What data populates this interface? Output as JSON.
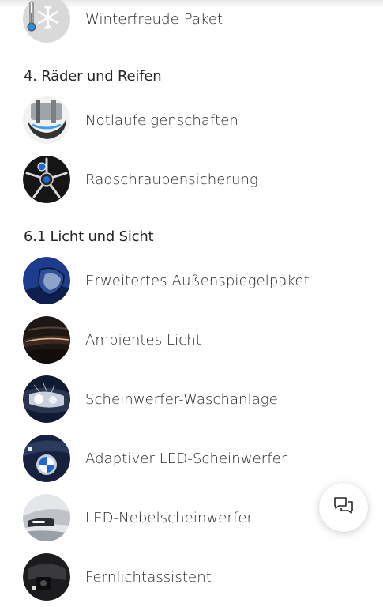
{
  "sections": [
    {
      "heading": "4. Räder und Reifen"
    },
    {
      "heading": "6.1 Licht und Sicht"
    }
  ],
  "items": [
    {
      "label": "Winterfreude Paket",
      "icon": "snowflake-thermometer"
    },
    {
      "label": "Notlaufeigenschaften",
      "icon": "runflat-tire"
    },
    {
      "label": "Radschraubensicherung",
      "icon": "wheel-rim"
    },
    {
      "label": "Erweitertes Außenspiegelpaket",
      "icon": "side-mirror"
    },
    {
      "label": "Ambientes Licht",
      "icon": "ambient-light"
    },
    {
      "label": "Scheinwerfer-Waschanlage",
      "icon": "headlight-washer"
    },
    {
      "label": "Adaptiver LED-Scheinwerfer",
      "icon": "led-headlight"
    },
    {
      "label": "LED-Nebelscheinwerfer",
      "icon": "fog-light"
    },
    {
      "label": "Fernlichtassistent",
      "icon": "high-beam-camera"
    }
  ],
  "chat": {
    "icon": "chat-bubbles-icon"
  }
}
